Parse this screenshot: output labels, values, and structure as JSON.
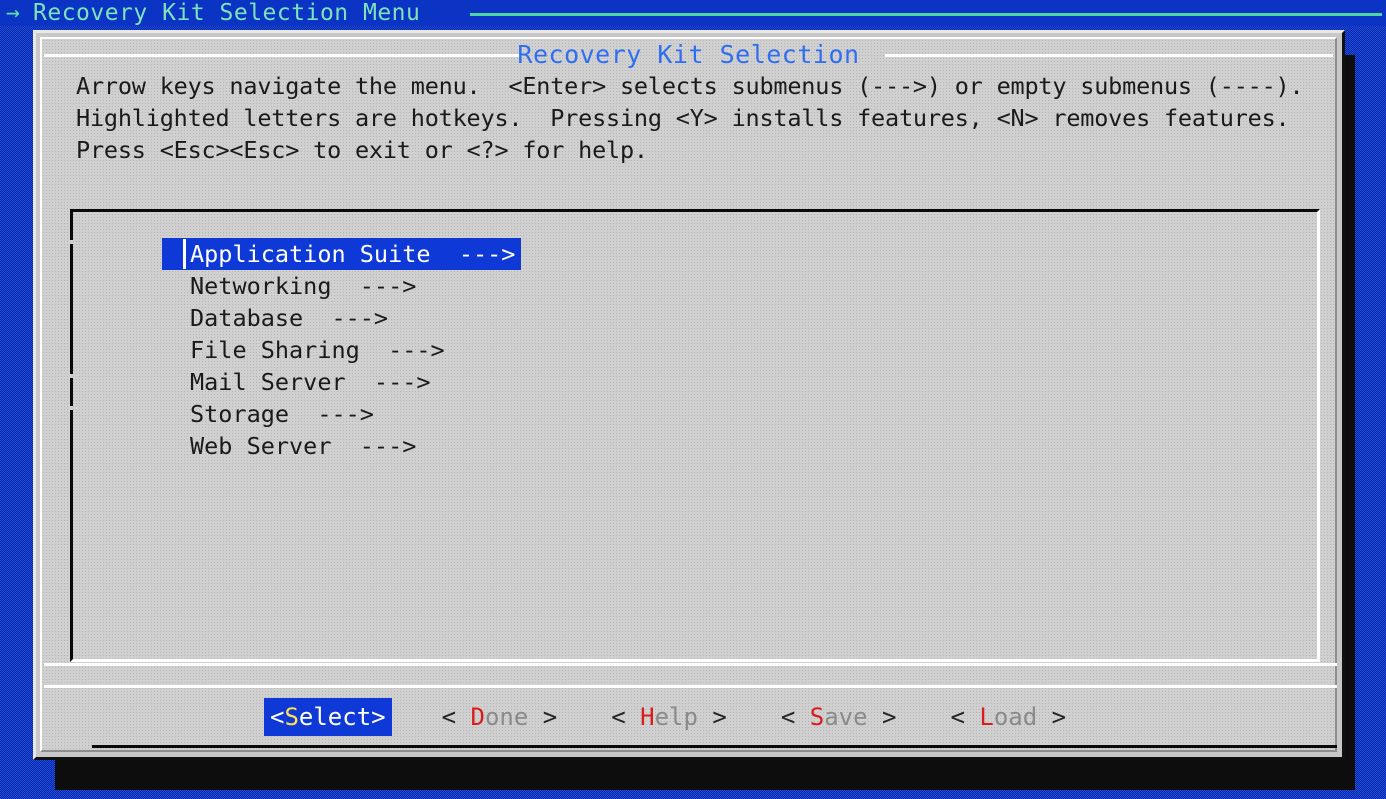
{
  "topbar": {
    "arrow_icon": "right-arrow-icon",
    "arrow_glyph": "→",
    "title": "Recovery Kit Selection Menu"
  },
  "dialog": {
    "title": "Recovery Kit Selection",
    "help_text": "Arrow keys navigate the menu.  <Enter> selects submenus (--->) or empty submenus (----).  Highlighted letters are hotkeys.  Pressing <Y> installs features, <N> removes features.  Press <Esc><Esc> to exit or <?> for help."
  },
  "menu": {
    "selected_index": 0,
    "items": [
      {
        "label": "Application Suite  --->",
        "submenu": true,
        "selected": true
      },
      {
        "label": "Networking  --->",
        "submenu": true,
        "selected": false
      },
      {
        "label": "Database  --->",
        "submenu": true,
        "selected": false
      },
      {
        "label": "File Sharing  --->",
        "submenu": true,
        "selected": false
      },
      {
        "label": "Mail Server  --->",
        "submenu": true,
        "selected": false
      },
      {
        "label": "Storage  --->",
        "submenu": true,
        "selected": false
      },
      {
        "label": "Web Server  --->",
        "submenu": true,
        "selected": false
      }
    ]
  },
  "buttons": [
    {
      "name": "select",
      "open": "<",
      "hotkey": "S",
      "rest": "elect",
      "close": ">",
      "active": true,
      "spaced": false
    },
    {
      "name": "done",
      "open": "<",
      "hotkey": "D",
      "rest": "one",
      "close": ">",
      "active": false,
      "spaced": true
    },
    {
      "name": "help",
      "open": "<",
      "hotkey": "H",
      "rest": "elp",
      "close": ">",
      "active": false,
      "spaced": true
    },
    {
      "name": "save",
      "open": "<",
      "hotkey": "S",
      "rest": "ave",
      "close": ">",
      "active": false,
      "spaced": true
    },
    {
      "name": "load",
      "open": "<",
      "hotkey": "L",
      "rest": "oad",
      "close": ">",
      "active": false,
      "spaced": true
    }
  ],
  "colors": {
    "desktop_blue": "#1a4fd6",
    "topbar_blue": "#0b34c4",
    "topbar_text_green": "#7fe3b8",
    "dialog_face": "#d0d0d0",
    "dialog_title_blue": "#2f6ef0",
    "highlight_blue": "#0f39d6",
    "hotkey_red": "#d81b1b",
    "hotkey_yellow": "#ffe14d",
    "text_black": "#1a1a1a",
    "button_gray": "#8a8a8a",
    "shadow_black": "#0d0d0d"
  }
}
